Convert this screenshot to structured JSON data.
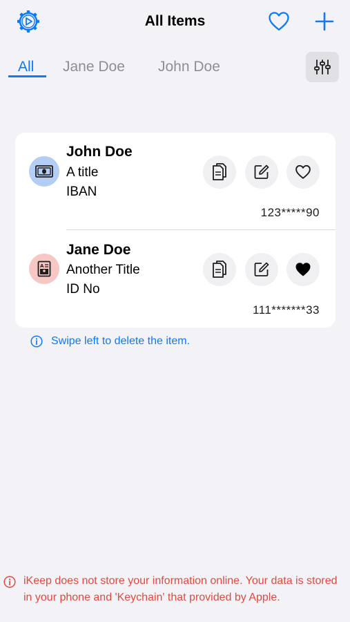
{
  "header": {
    "title": "All Items",
    "settings_icon": "gear-icon",
    "favorites_icon": "heart-icon",
    "add_icon": "plus-icon",
    "accent_color": "#0A7AFF"
  },
  "tabs": [
    {
      "label": "All",
      "active": true
    },
    {
      "label": "Jane Doe",
      "active": false
    },
    {
      "label": "John Doe",
      "active": false
    }
  ],
  "filter": {
    "icon": "sliders-icon"
  },
  "items": [
    {
      "owner": "John Doe",
      "title": "A title",
      "type": "IBAN",
      "value": "123*****90",
      "icon": "banknote-icon",
      "favorite": false
    },
    {
      "owner": "Jane Doe",
      "title": "Another Title",
      "type": "ID No",
      "value": "111*******33",
      "icon": "id-card-icon",
      "favorite": true
    }
  ],
  "hint": {
    "text": "Swipe left to delete the item.",
    "color": "#0A7AFF"
  },
  "footer": {
    "text": "iKeep does not store your information online. Your data is stored in your phone and 'Keychain' that provided by Apple.",
    "color": "#E5483C"
  }
}
